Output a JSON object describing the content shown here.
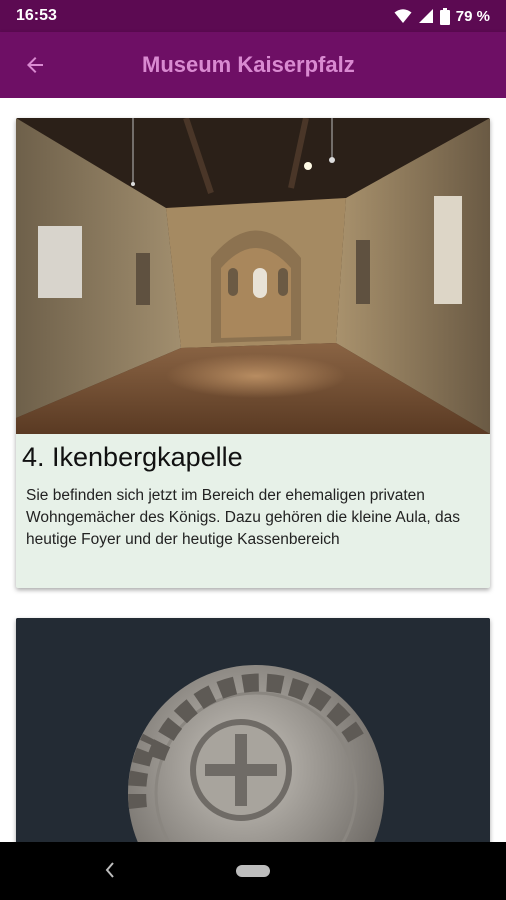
{
  "status_bar": {
    "time": "16:53",
    "battery": "79 %"
  },
  "app_bar": {
    "title": "Museum Kaiserpfalz",
    "back_icon": "arrow-back-icon"
  },
  "stations": [
    {
      "title": "4. Ikenbergkapelle",
      "description": "Sie befinden sich jetzt im Bereich der ehemaligen privaten Wohngemächer des Königs. Dazu gehören die kleine Aula, das heutige Foyer und der heutige Kassenbereich",
      "image": "chapel-interior-photo"
    },
    {
      "title": "",
      "description": "",
      "image": "coin-photo"
    }
  ],
  "colors": {
    "status_bar": "#5c0a52",
    "app_bar": "#6e0f65",
    "title_text": "#d98ad1",
    "card_bg": "#e7f1e8"
  }
}
